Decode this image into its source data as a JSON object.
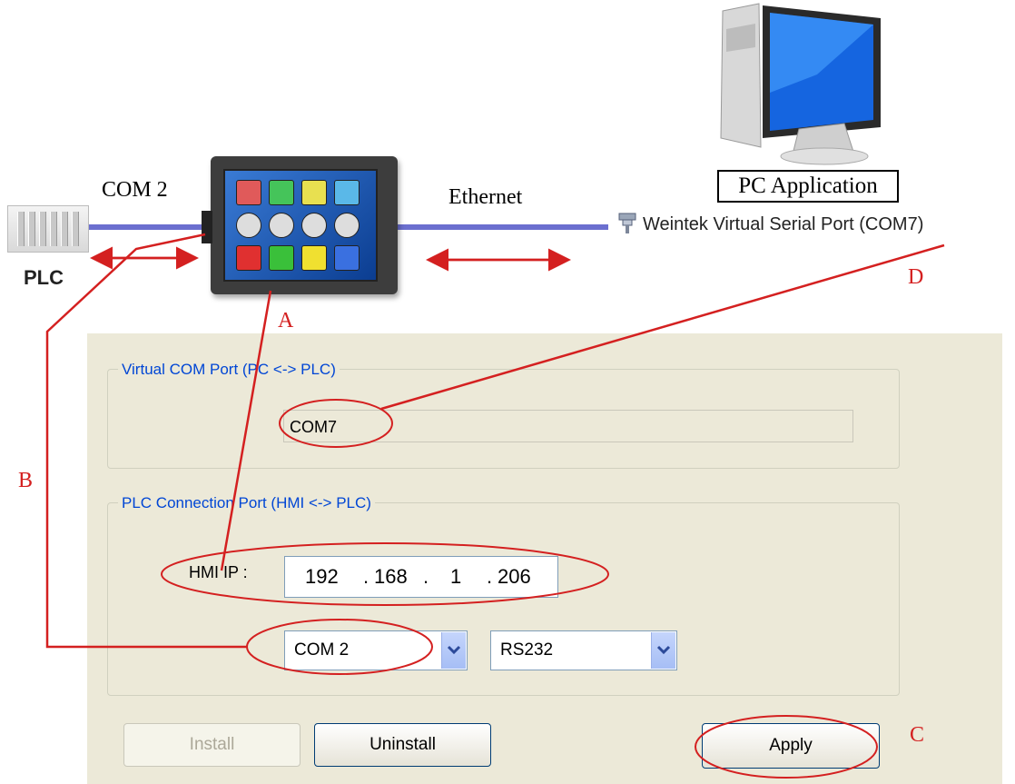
{
  "diagram": {
    "plc_label": "PLC",
    "com_label": "COM 2",
    "ethernet_label": "Ethernet",
    "pc_app_label": "PC Application",
    "serial_port_label": "Weintek Virtual Serial Port (COM7)",
    "markers": {
      "a": "A",
      "b": "B",
      "c": "C",
      "d": "D"
    },
    "colors": {
      "cable": "#6b6fcf",
      "annotation": "#d42020"
    }
  },
  "dialog": {
    "virtual_group_title": "Virtual COM Port (PC <-> PLC)",
    "virtual_com_value": "COM7",
    "plc_group_title": "PLC Connection Port (HMI <-> PLC)",
    "hmi_ip_label": "HMI IP :",
    "ip": {
      "o1": "192",
      "o2": "168",
      "o3": "1",
      "o4": "206",
      "dot": "."
    },
    "com_select": "COM 2",
    "interface_select": "RS232",
    "install_label": "Install",
    "uninstall_label": "Uninstall",
    "apply_label": "Apply"
  }
}
